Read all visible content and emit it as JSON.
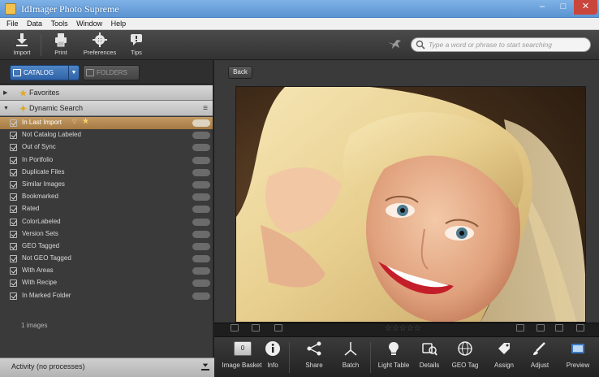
{
  "window": {
    "title": "IdImager Photo Supreme",
    "controls": {
      "minimize": "–",
      "maximize": "□",
      "close": "✕"
    }
  },
  "menu": [
    "File",
    "Data",
    "Tools",
    "Window",
    "Help"
  ],
  "toolbar": {
    "buttons": [
      {
        "label": "Import",
        "icon": "import-icon"
      },
      {
        "label": "Print",
        "icon": "print-icon"
      },
      {
        "label": "Preferences",
        "icon": "gear-icon"
      },
      {
        "label": "Tips",
        "icon": "tips-icon"
      }
    ],
    "search_placeholder": "Type a word or phrase to start searching"
  },
  "left_panel": {
    "tabs": {
      "catalog": "CATALOG",
      "folders": "FOLDERS",
      "dropdown": "▼"
    },
    "sections": {
      "favorites": "Favorites",
      "dynamic_search": "Dynamic Search"
    },
    "items": [
      {
        "label": "In Last Import",
        "selected": true
      },
      {
        "label": "Not Catalog Labeled"
      },
      {
        "label": "Out of Sync"
      },
      {
        "label": "In Portfolio"
      },
      {
        "label": "Duplicate Files"
      },
      {
        "label": "Similar Images"
      },
      {
        "label": "Bookmarked"
      },
      {
        "label": "Rated"
      },
      {
        "label": "ColorLabeled"
      },
      {
        "label": "Version Sets"
      },
      {
        "label": "GEO Tagged"
      },
      {
        "label": "Not GEO Tagged"
      },
      {
        "label": "With Areas"
      },
      {
        "label": "With Recipe"
      },
      {
        "label": "In Marked Folder"
      }
    ],
    "image_count": "1 images",
    "activity": "Activity (no processes)"
  },
  "viewer": {
    "back_label": "Back",
    "rating": "☆☆☆☆☆"
  },
  "bottom_bar": {
    "basket_count": "0",
    "buttons": [
      {
        "label": "Image Basket",
        "icon": "image-basket-icon"
      },
      {
        "label": "Info",
        "icon": "info-icon"
      },
      {
        "label": "Share",
        "icon": "share-icon"
      },
      {
        "label": "Batch",
        "icon": "batch-icon"
      },
      {
        "label": "Light Table",
        "icon": "light-table-icon"
      },
      {
        "label": "Details",
        "icon": "details-icon"
      },
      {
        "label": "GEO Tag",
        "icon": "geo-tag-icon"
      },
      {
        "label": "Assign",
        "icon": "assign-icon"
      },
      {
        "label": "Adjust",
        "icon": "adjust-icon"
      },
      {
        "label": "Preview",
        "icon": "preview-icon"
      }
    ]
  },
  "colors": {
    "selection": "#b88c53",
    "catalog_tab": "#3f73b8",
    "title_bar": "#6ea3dd"
  }
}
